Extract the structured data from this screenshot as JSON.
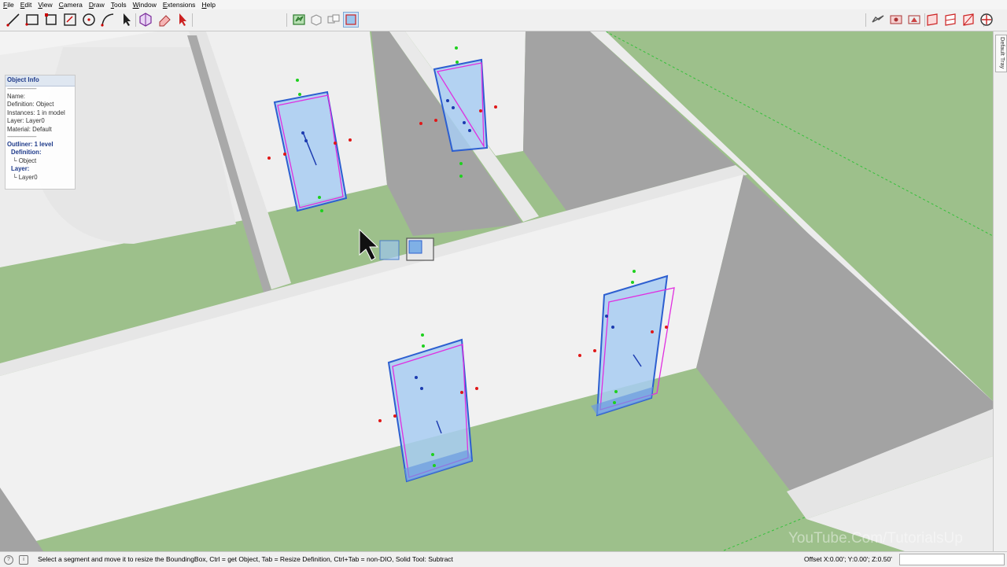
{
  "menu": [
    "File",
    "Edit",
    "View",
    "Camera",
    "Draw",
    "Tools",
    "Window",
    "Extensions",
    "Help"
  ],
  "toolbar": {
    "left_tools": [
      {
        "name": "line-tool-icon"
      },
      {
        "name": "rectangle-tool-icon"
      },
      {
        "name": "rotated-rectangle-tool-icon"
      },
      {
        "name": "offset-rectangle-tool-icon"
      },
      {
        "name": "circle-tool-icon"
      },
      {
        "name": "arc-tool-icon"
      },
      {
        "name": "select-tool-icon"
      },
      {
        "name": "scale-tool-icon"
      },
      {
        "name": "eraser-tool-icon"
      },
      {
        "name": "arrow-cursor-tool-icon"
      }
    ],
    "mid_tools": [
      {
        "name": "solid-tools-icon"
      },
      {
        "name": "object-box-icon"
      },
      {
        "name": "object-copy-icon"
      },
      {
        "name": "bounding-box-icon"
      }
    ],
    "right_tools": [
      {
        "name": "sandbox-icon"
      },
      {
        "name": "trace-icon"
      },
      {
        "name": "render-icon"
      },
      {
        "name": "section-plane-icon"
      },
      {
        "name": "display-section-icon"
      },
      {
        "name": "section-cut-icon"
      },
      {
        "name": "extension-warehouse-icon"
      }
    ]
  },
  "tray": {
    "label": "Default Tray"
  },
  "object_info": {
    "title": "Object Info",
    "dash": "-----------------------",
    "name": "Name:",
    "definition": "Definition: Object",
    "instances": "Instances: 1 in model",
    "layer": "Layer: Layer0",
    "material": "Material: Default",
    "dash2": "-----------------------",
    "outliner": "Outliner: 1 level",
    "def_header": "Definition:",
    "def_value": "└ Object",
    "layer_header": "Layer:",
    "layer_value": "└ Layer0"
  },
  "status": {
    "message": "Select a segment and move it to resize the BoundingBox, Ctrl = get Object, Tab = Resize Definition, Ctrl+Tab = non-DIO, Solid Tool: Subtract",
    "measurements": "Offset X:0.00';  Y:0.00';  Z:0.50'",
    "vcb_value": ""
  },
  "watermark": "YouTube.Com/TutorialsUp",
  "colors": {
    "grass": "#9dc08b",
    "wall": "#ececec",
    "wall_shadow": "#a3a3a3",
    "box_fill": "#a8cdf2",
    "box_edge": "#2d5fd0",
    "box_accent": "#e02ee0"
  }
}
